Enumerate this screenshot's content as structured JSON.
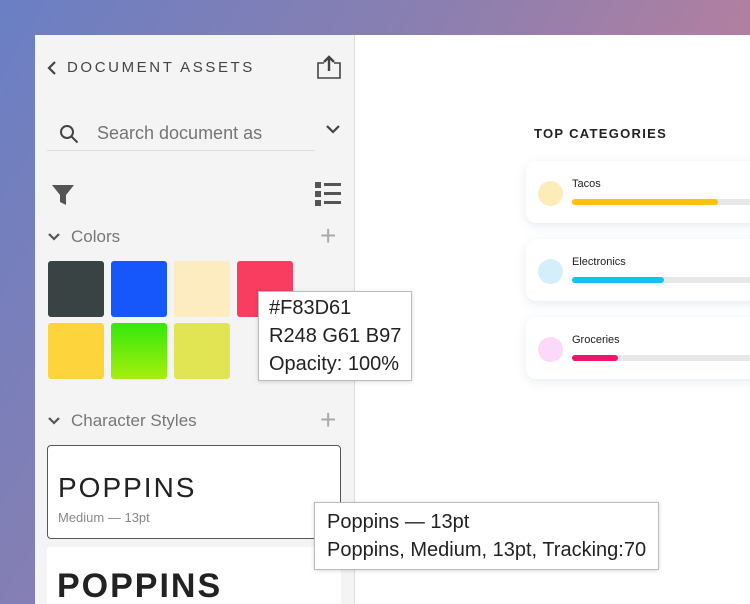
{
  "sidebar": {
    "title": "DOCUMENT ASSETS",
    "search_placeholder": "Search document as",
    "sections": {
      "colors": "Colors",
      "character_styles": "Character Styles"
    },
    "colors": [
      "#3a4344",
      "#1657fb",
      "#fcecc0",
      "#f83d61",
      "#fdd43c",
      "#6ae80c",
      "#e1e553"
    ],
    "character_styles": [
      {
        "name": "POPPINS",
        "detail": "Medium — 13pt"
      },
      {
        "name": "POPPINS"
      }
    ]
  },
  "main": {
    "title": "TOP CATEGORIES",
    "categories": [
      {
        "label": "Tacos",
        "percent": 73,
        "dot": "#fcecb8",
        "bar": "#fcc10a"
      },
      {
        "label": "Electronics",
        "percent": 46,
        "dot": "#d4eefc",
        "bar": "#0bc5ee"
      },
      {
        "label": "Groceries",
        "percent": 23,
        "dot": "#fcd8fa",
        "bar": "#f5126c"
      }
    ]
  },
  "tooltips": {
    "color": {
      "hex": "#F83D61",
      "rgb": "R248 G61 B97",
      "opacity": "Opacity: 100%"
    },
    "style": {
      "line1": "Poppins — 13pt",
      "line2": "Poppins, Medium, 13pt, Tracking:70"
    }
  }
}
